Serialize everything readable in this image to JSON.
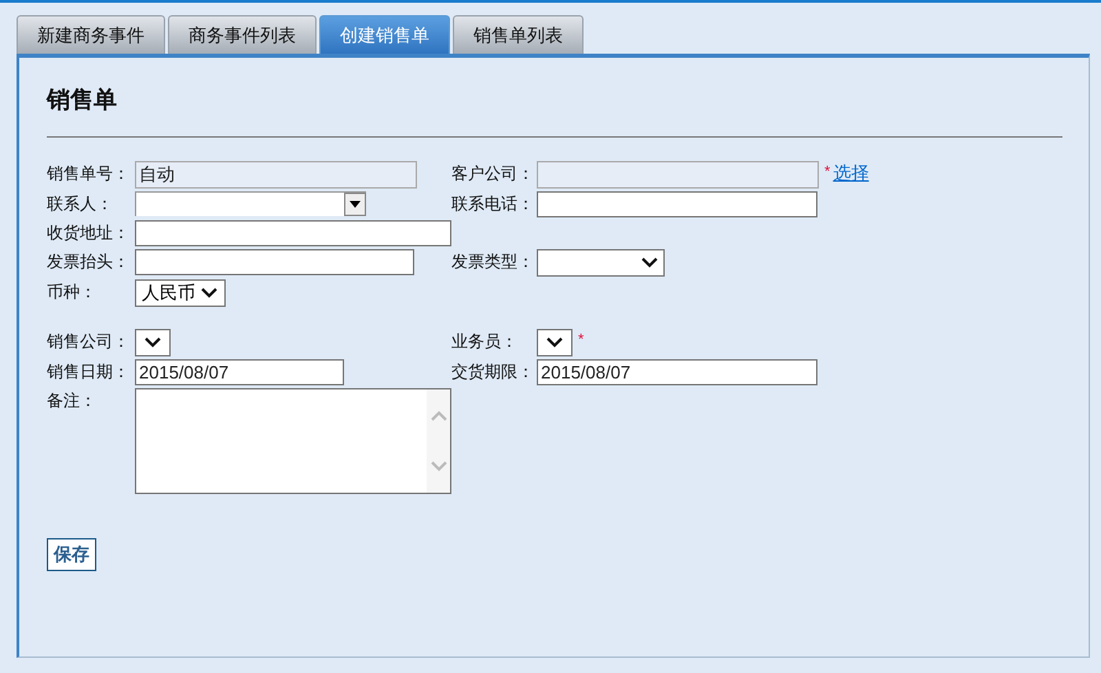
{
  "tabs": [
    {
      "label": "新建商务事件",
      "selected": false
    },
    {
      "label": "商务事件列表",
      "selected": false
    },
    {
      "label": "创建销售单",
      "selected": true
    },
    {
      "label": "销售单列表",
      "selected": false
    }
  ],
  "title": "销售单",
  "required_mark": "*",
  "groups": [
    [
      {
        "left": {
          "label": "销售单号：",
          "kind": "readonly",
          "value": "自动"
        },
        "right": {
          "label": "客户公司：",
          "kind": "readonly",
          "required": true,
          "link": "选择"
        }
      },
      {
        "left": {
          "label": "联系人：",
          "kind": "combo"
        },
        "right": {
          "label": "联系电话：",
          "kind": "text"
        }
      },
      {
        "left": {
          "label": "收货地址：",
          "kind": "wide"
        }
      },
      {
        "left": {
          "label": "发票抬头：",
          "kind": "text"
        },
        "right": {
          "label": "发票类型：",
          "kind": "select"
        }
      },
      {
        "left": {
          "label": "币种：",
          "kind": "select",
          "value": "人民币"
        }
      }
    ],
    [
      {
        "left": {
          "label": "销售公司：",
          "kind": "select"
        },
        "right": {
          "label": "业务员：",
          "kind": "select",
          "required": true
        }
      },
      {
        "left": {
          "label": "销售日期：",
          "kind": "text",
          "value": "2015/08/07"
        },
        "right": {
          "label": "交货期限：",
          "kind": "text",
          "value": "2015/08/07"
        }
      },
      {
        "left": {
          "label": "备注：",
          "kind": "textarea"
        }
      }
    ]
  ],
  "save": "保存"
}
